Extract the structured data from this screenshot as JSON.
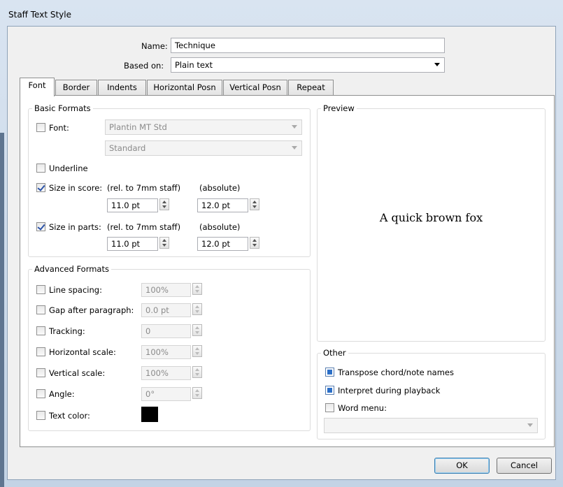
{
  "window": {
    "title": "Staff Text Style"
  },
  "header": {
    "name_label": "Name:",
    "name_value": "Technique",
    "based_on_label": "Based on:",
    "based_on_value": "Plain text"
  },
  "tabs": [
    {
      "label": "Font",
      "active": true
    },
    {
      "label": "Border"
    },
    {
      "label": "Indents"
    },
    {
      "label": "Horizontal Posn"
    },
    {
      "label": "Vertical Posn"
    },
    {
      "label": "Repeat"
    }
  ],
  "basic": {
    "title": "Basic Formats",
    "font_label": "Font:",
    "font_checked": false,
    "font_value": "Plantin MT Std",
    "font_style_value": "Standard",
    "underline_label": "Underline",
    "underline_checked": false,
    "size_score_label": "Size in score:",
    "size_score_checked": true,
    "size_parts_label": "Size in parts:",
    "size_parts_checked": true,
    "rel_label": "(rel. to 7mm staff)",
    "abs_label": "(absolute)",
    "score_rel": "11.0 pt",
    "score_abs": "12.0 pt",
    "parts_rel": "11.0 pt",
    "parts_abs": "12.0 pt"
  },
  "advanced": {
    "title": "Advanced Formats",
    "line_spacing_label": "Line spacing:",
    "line_spacing_value": "100%",
    "gap_label": "Gap after paragraph:",
    "gap_value": "0.0 pt",
    "tracking_label": "Tracking:",
    "tracking_value": "0",
    "hscale_label": "Horizontal scale:",
    "hscale_value": "100%",
    "vscale_label": "Vertical scale:",
    "vscale_value": "100%",
    "angle_label": "Angle:",
    "angle_value": "0°",
    "color_label": "Text color:",
    "color_value": "#000000"
  },
  "preview": {
    "title": "Preview",
    "text": "A quick brown fox"
  },
  "other": {
    "title": "Other",
    "transpose_label": "Transpose chord/note names",
    "transpose_checked": true,
    "interpret_label": "Interpret during playback",
    "interpret_checked": true,
    "word_menu_label": "Word menu:",
    "word_menu_checked": false,
    "word_menu_value": ""
  },
  "buttons": {
    "ok": "OK",
    "cancel": "Cancel"
  },
  "colors": {
    "accent_blue": "#2c6fc7",
    "title_bg": "#cfdbe8"
  }
}
